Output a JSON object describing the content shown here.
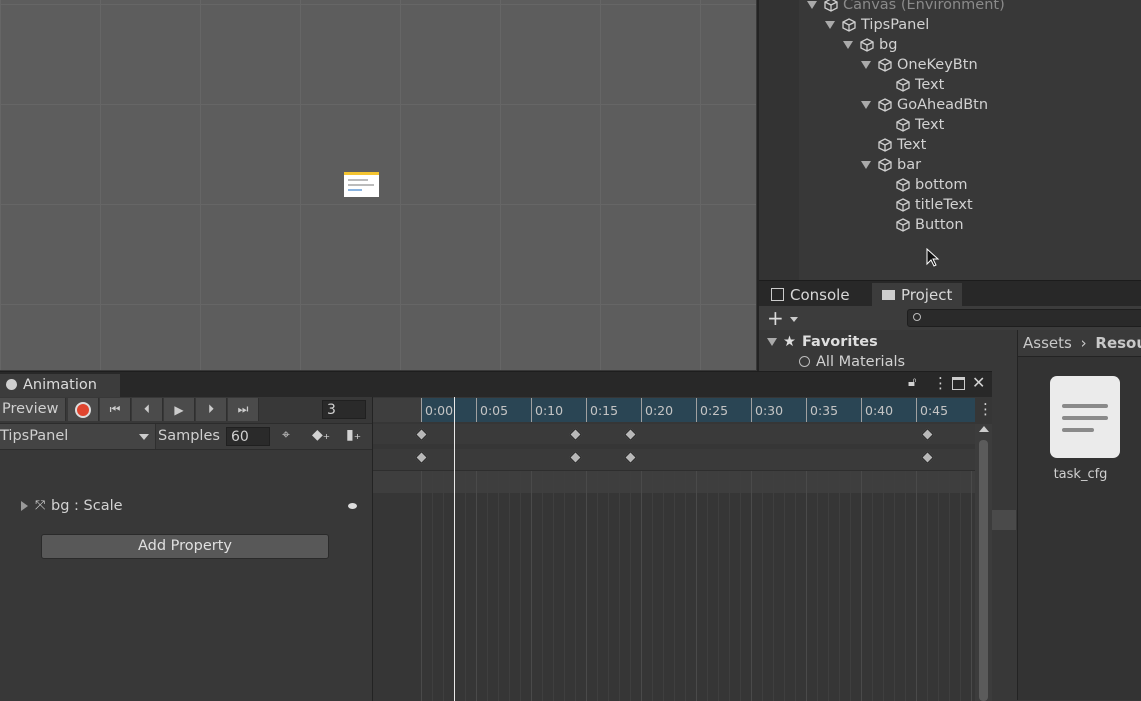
{
  "hierarchy": {
    "items": [
      {
        "label": "Canvas (Environment)",
        "expanded": true,
        "dim": true
      },
      {
        "label": "TipsPanel",
        "expanded": true
      },
      {
        "label": "bg",
        "expanded": true
      },
      {
        "label": "OneKeyBtn",
        "expanded": true
      },
      {
        "label": "Text",
        "expanded": false
      },
      {
        "label": "GoAheadBtn",
        "expanded": true
      },
      {
        "label": "Text",
        "expanded": false
      },
      {
        "label": "Text",
        "expanded": false
      },
      {
        "label": "bar",
        "expanded": true
      },
      {
        "label": "bottom",
        "expanded": false
      },
      {
        "label": "titleText",
        "expanded": false
      },
      {
        "label": "Button",
        "expanded": false
      }
    ]
  },
  "project": {
    "tabs": [
      {
        "label": "Console",
        "icon": "console-icon"
      },
      {
        "label": "Project",
        "icon": "folder-icon"
      }
    ],
    "add_label": "+",
    "favorites_label": "Favorites",
    "all_materials_label": "All Materials",
    "breadcrumb": [
      "Assets",
      "Resour"
    ],
    "asset_name": "task_cfg"
  },
  "animation": {
    "tab_label": "Animation",
    "preview_label": "Preview",
    "frame": "3",
    "clip_name": "TipsPanel",
    "samples_label": "Samples",
    "samples_value": "60",
    "property_label": "bg : Scale",
    "add_property_label": "Add Property",
    "ruler_ticks": [
      "0:00",
      "0:05",
      "0:10",
      "0:15",
      "0:20",
      "0:25",
      "0:30",
      "0:35",
      "0:40",
      "0:45"
    ],
    "keyframes_at": [
      "0:00",
      "0:14",
      "0:19",
      "0:46"
    ],
    "playhead_at": "0:03",
    "colors": {
      "record": "#e0452f",
      "clip_range": "#2a4554"
    }
  }
}
